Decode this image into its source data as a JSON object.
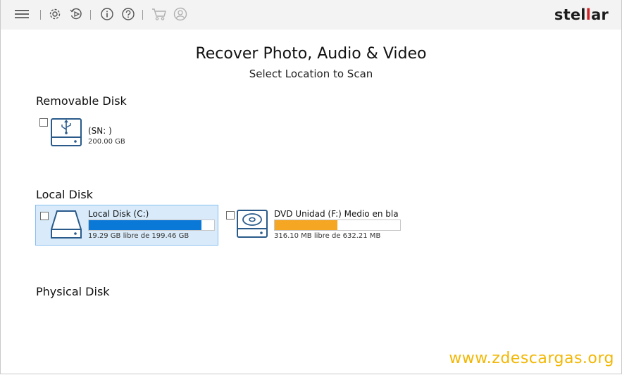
{
  "toolbar": {
    "icons": [
      "menu-icon",
      "gear-icon",
      "resume-icon",
      "info-icon",
      "help-icon",
      "cart-icon",
      "user-icon"
    ]
  },
  "brand": {
    "logo_a": "stel",
    "logo_hl": "l",
    "logo_b": "ar",
    "color_primary": "#1b1b1b",
    "color_accent": "#d42027"
  },
  "header": {
    "title": "Recover Photo, Audio & Video",
    "subtitle": "Select Location to Scan"
  },
  "sections": {
    "removable": {
      "label": "Removable Disk",
      "drives": [
        {
          "name": "(SN: )",
          "size": "200.00 GB",
          "icon": "usb-drive-icon",
          "checked": false
        }
      ]
    },
    "local": {
      "label": "Local Disk",
      "drives": [
        {
          "name": "Local Disk (C:)",
          "size": "19.29 GB libre de 199.46 GB",
          "icon": "hard-drive-icon",
          "checked": false,
          "selected": true,
          "used_fraction": 0.9,
          "bar_color": "#0a78d7"
        },
        {
          "name": "DVD Unidad (F:) Medio en bla",
          "size": "316.10 MB libre de 632.21 MB",
          "icon": "dvd-drive-icon",
          "checked": false,
          "selected": false,
          "used_fraction": 0.5,
          "bar_color": "#f5a623"
        }
      ]
    },
    "physical": {
      "label": "Physical Disk",
      "drives": []
    }
  },
  "watermark": "www.zdescargas.org"
}
